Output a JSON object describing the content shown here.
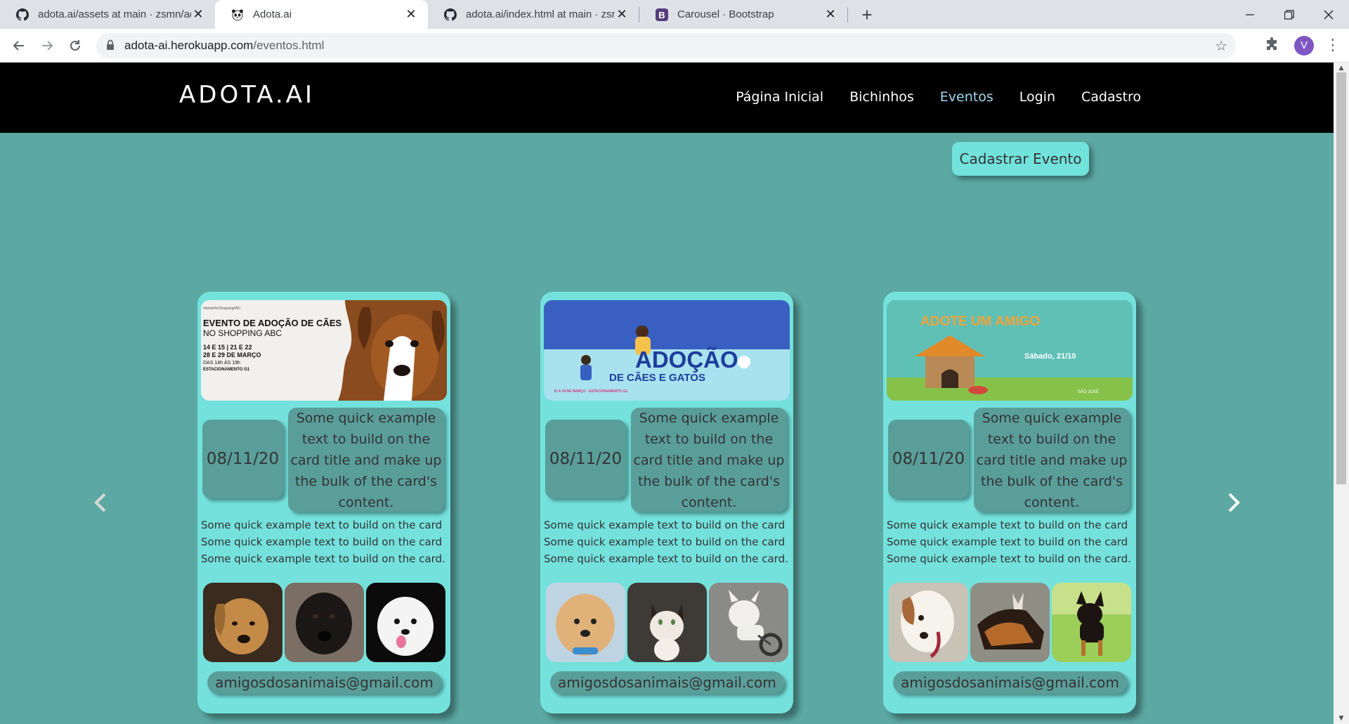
{
  "browser": {
    "tabs": [
      {
        "title": "adota.ai/assets at main · zsmn/ad",
        "icon": "github-icon"
      },
      {
        "title": "Adota.ai",
        "icon": "panda-icon"
      },
      {
        "title": "adota.ai/index.html at main · zsm",
        "icon": "github-icon"
      },
      {
        "title": "Carousel · Bootstrap",
        "icon": "bootstrap-icon"
      }
    ],
    "url_host": "adota-ai.herokuapp.com",
    "url_path": "/eventos.html",
    "profile_initial": "V"
  },
  "site": {
    "brand": "ADOTA.AI",
    "nav": [
      "Página Inicial",
      "Bichinhos",
      "Eventos",
      "Login",
      "Cadastro"
    ],
    "active_nav": "Eventos",
    "cadastrar_button": "Cadastrar Evento",
    "colors": {
      "page_bg": "#5ca8a2",
      "card_bg": "#74e1dc",
      "pill_bg": "#5a9e9a",
      "nav_bg": "#000000",
      "active_link": "#9fd6ef"
    }
  },
  "cards": [
    {
      "banner": {
        "tag": "#AdoteNoShoppingABC",
        "title": "EVENTO DE ADOÇÃO DE CÃES",
        "subtitle": "NO SHOPPING ABC",
        "dates": "14 E 15 | 21 E 22",
        "dates2": "28 E 29 DE MARÇO",
        "hours": "DAS 14h ÀS 19h",
        "place": "ESTACIONAMENTO G1"
      },
      "date": "08/11/20",
      "description": "Some quick example text to build on the card title and make up the bulk of the card's content.",
      "lines": [
        "Some quick example text to build on the card",
        "Some quick example text to build on the card",
        "Some quick example text to build on the card."
      ],
      "email": "amigosdosanimais@gmail.com"
    },
    {
      "banner": {
        "title": "ADOÇÃO",
        "subtitle": "DE CÃES E GATOS",
        "footer": "12 A 15 DE MARÇO - ESTACIONAMENTO G1"
      },
      "date": "08/11/20",
      "description": "Some quick example text to build on the card title and make up the bulk of the card's content.",
      "lines": [
        "Some quick example text to build on the card",
        "Some quick example text to build on the card",
        "Some quick example text to build on the card."
      ],
      "email": "amigosdosanimais@gmail.com"
    },
    {
      "banner": {
        "title": "ADOTE UM AMIGO",
        "day": "Sábado, 21/10",
        "org": "SÃO JOSÉ"
      },
      "date": "08/11/20",
      "description": "Some quick example text to build on the card title and make up the bulk of the card's content.",
      "lines": [
        "Some quick example text to build on the card",
        "Some quick example text to build on the card",
        "Some quick example text to build on the card."
      ],
      "email": "amigosdosanimais@gmail.com"
    }
  ]
}
